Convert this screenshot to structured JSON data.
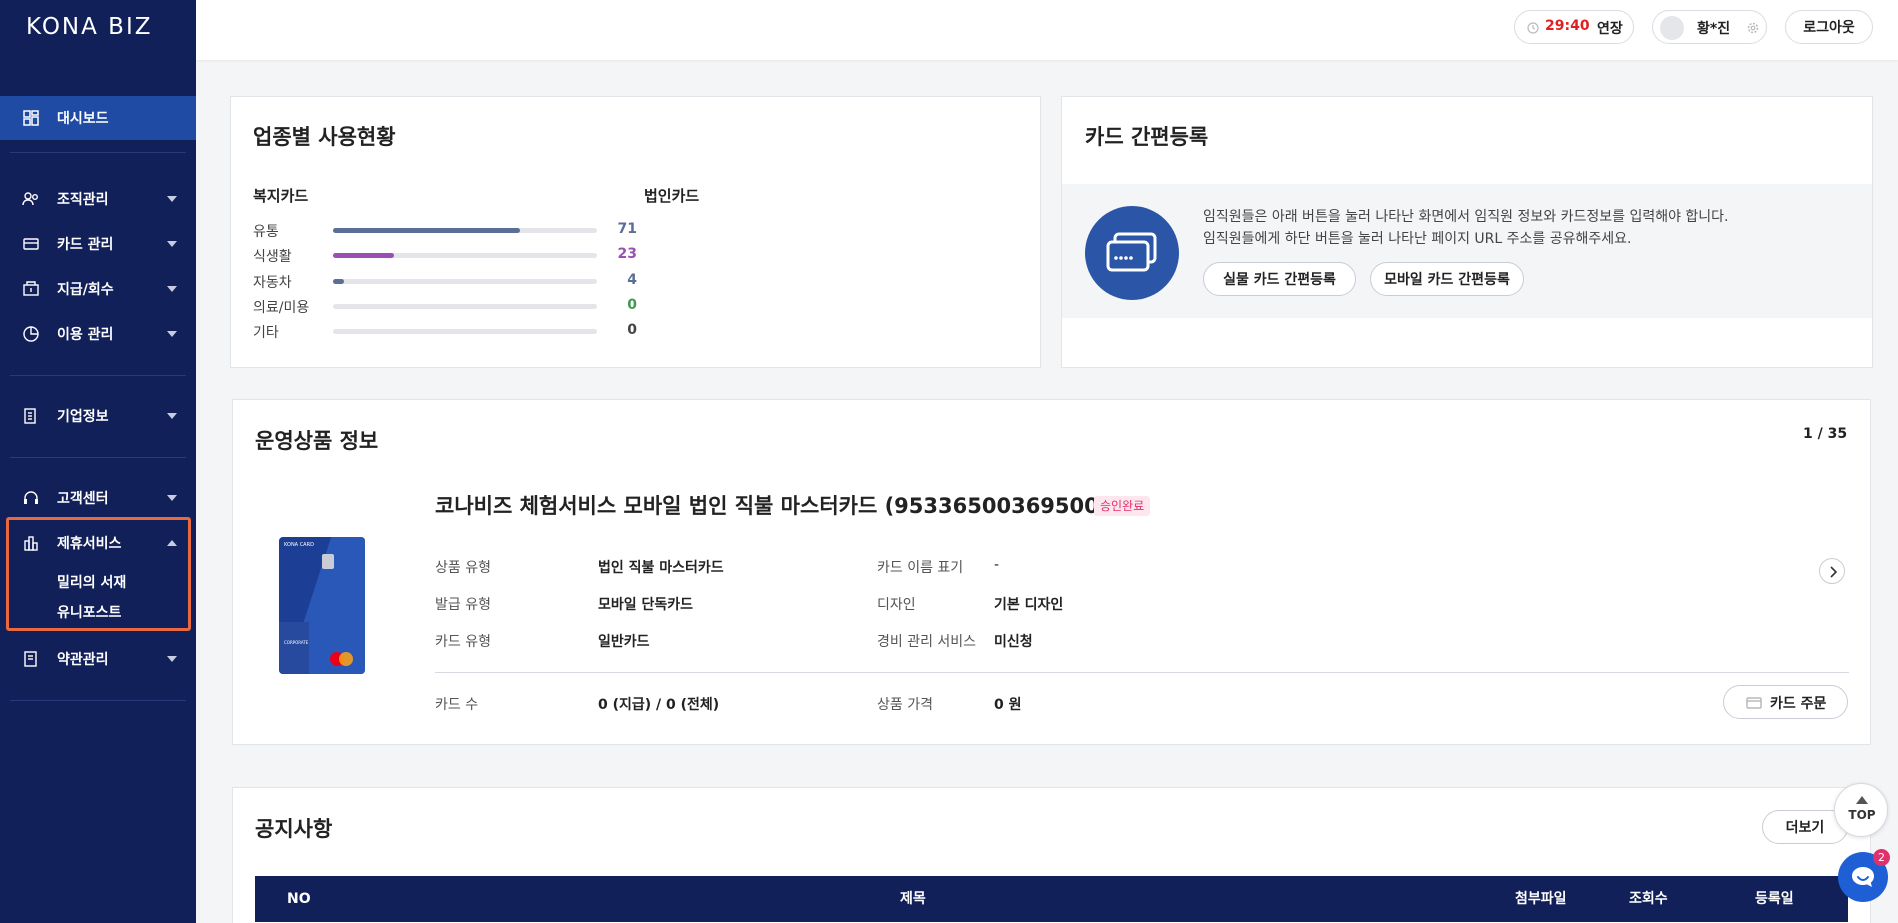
{
  "brand": {
    "logo": "KONA BIZ"
  },
  "sidebar": {
    "items": [
      {
        "label": "대시보드",
        "icon": "dashboard-icon"
      },
      {
        "label": "조직관리",
        "icon": "organization-icon"
      },
      {
        "label": "카드 관리",
        "icon": "card-icon"
      },
      {
        "label": "지급/회수",
        "icon": "payment-icon"
      },
      {
        "label": "이용 관리",
        "icon": "usage-chart-icon"
      },
      {
        "label": "기업정보",
        "icon": "company-icon"
      },
      {
        "label": "고객센터",
        "icon": "headset-icon"
      },
      {
        "label": "제휴서비스",
        "icon": "partner-building-icon"
      },
      {
        "label": "약관관리",
        "icon": "terms-document-icon"
      }
    ],
    "partner_sub": [
      "밀리의 서재",
      "유니포스트"
    ]
  },
  "header": {
    "timer": "29:40",
    "extend_label": "연장",
    "user_name": "황*진",
    "logout_label": "로그아웃"
  },
  "industry": {
    "title": "업종별 사용현황",
    "welfare_label": "복지카드",
    "corporate_label": "법인카드",
    "rows": [
      {
        "name": "유통",
        "value": "71",
        "fraction": 0.71,
        "color": "#5b6e96"
      },
      {
        "name": "식생활",
        "value": "23",
        "fraction": 0.23,
        "color": "#9b4fb5"
      },
      {
        "name": "자동차",
        "value": "4",
        "fraction": 0.04,
        "color": "#5b6e96"
      },
      {
        "name": "의료/미용",
        "value": "0",
        "fraction": 0,
        "color": "#3f9a4f"
      },
      {
        "name": "기타",
        "value": "0",
        "fraction": 0,
        "color": "#444444"
      }
    ]
  },
  "quick_register": {
    "title": "카드 간편등록",
    "line1": "임직원들은 아래 버튼을 눌러 나타난 화면에서 임직원 정보와 카드정보를 입력해야 합니다.",
    "line2": "임직원들에게 하단 버튼을 눌러 나타난 페이지 URL 주소를 공유해주세요.",
    "physical_btn": "실물 카드 간편등록",
    "mobile_btn": "모바일 카드 간편등록"
  },
  "product": {
    "title": "운영상품 정보",
    "page": "1 / 35",
    "name": "코나비즈 체험서비스 모바일 법인 직불 마스터카드 (953365003695000)",
    "badge": "승인완료",
    "card_face_brand": "KONA CARD",
    "card_face_tag": "CORPORATE",
    "fields": {
      "product_type_label": "상품 유형",
      "product_type": "법인 직불 마스터카드",
      "issue_type_label": "발급 유형",
      "issue_type": "모바일 단독카드",
      "card_type_label": "카드 유형",
      "card_type": "일반카드",
      "name_display_label": "카드 이름 표기",
      "name_display": "-",
      "design_label": "디자인",
      "design": "기본 디자인",
      "expense_label": "경비 관리 서비스",
      "expense": "미신청",
      "count_label": "카드 수",
      "count": "0 (지급) / 0 (전체)",
      "price_label": "상품 가격",
      "price": "0 원"
    },
    "order_btn": "카드 주문"
  },
  "notice": {
    "title": "공지사항",
    "more": "더보기",
    "columns": [
      "NO",
      "제목",
      "첨부파일",
      "조회수",
      "등록일"
    ]
  },
  "floating": {
    "top_label": "TOP",
    "chat_badge": "2"
  },
  "colors": {
    "sidebar": "#112059",
    "active": "#1f4ba5",
    "timer": "#e02020",
    "badge": "#e0316a",
    "highlight": "#e8693f"
  }
}
